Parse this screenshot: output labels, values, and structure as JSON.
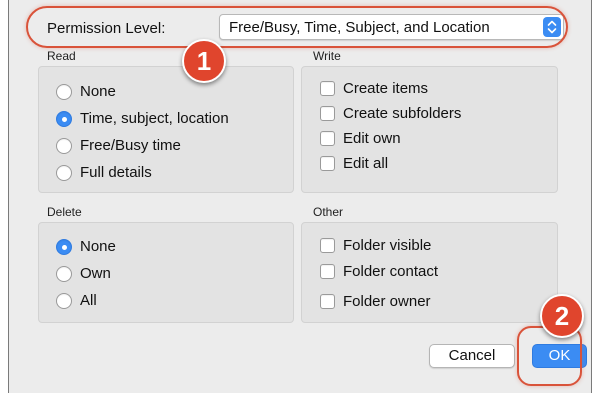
{
  "permission": {
    "label": "Permission Level:",
    "selected": "Free/Busy, Time, Subject, and Location"
  },
  "callouts": [
    "1",
    "2"
  ],
  "read": {
    "title": "Read",
    "options": [
      {
        "label": "None",
        "selected": false
      },
      {
        "label": "Time, subject, location",
        "selected": true
      },
      {
        "label": "Free/Busy time",
        "selected": false
      },
      {
        "label": "Full details",
        "selected": false
      }
    ]
  },
  "write": {
    "title": "Write",
    "options": [
      {
        "label": "Create items",
        "checked": false
      },
      {
        "label": "Create subfolders",
        "checked": false
      },
      {
        "label": "Edit own",
        "checked": false
      },
      {
        "label": "Edit all",
        "checked": false
      }
    ]
  },
  "delete": {
    "title": "Delete",
    "options": [
      {
        "label": "None",
        "selected": true
      },
      {
        "label": "Own",
        "selected": false
      },
      {
        "label": "All",
        "selected": false
      }
    ]
  },
  "other": {
    "title": "Other",
    "options": [
      {
        "label": "Folder visible",
        "checked": false
      },
      {
        "label": "Folder contact",
        "checked": false
      },
      {
        "label": "Folder owner",
        "checked": false
      }
    ]
  },
  "buttons": {
    "cancel": "Cancel",
    "ok": "OK"
  },
  "colors": {
    "accent": "#3b8cf3",
    "annotation": "#e0452d",
    "dialog_bg": "#ececec"
  }
}
